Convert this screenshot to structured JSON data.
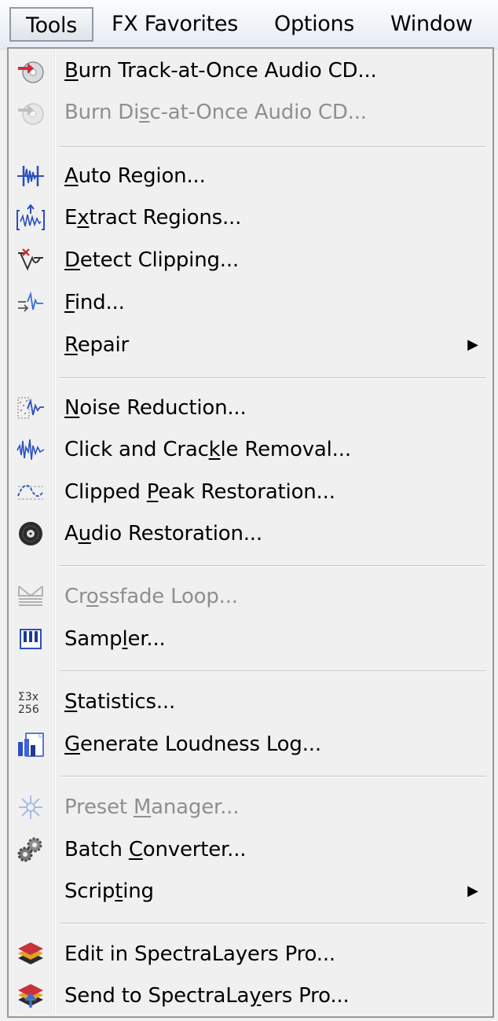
{
  "menubar": {
    "tools": "Tools",
    "fx_favorites": "FX Favorites",
    "options": "Options",
    "window": "Window"
  },
  "menu": {
    "items": [
      {
        "icon": "burn-cd-icon",
        "pre": "",
        "key": "B",
        "post": "urn Track-at-Once Audio CD..."
      },
      {
        "icon": "burn-cd-icon",
        "pre": "Burn Di",
        "key": "s",
        "post": "c-at-Once Audio CD..."
      },
      {
        "icon": "auto-region-icon",
        "pre": "",
        "key": "A",
        "post": "uto Region..."
      },
      {
        "icon": "extract-regions-icon",
        "pre": "E",
        "key": "x",
        "post": "tract Regions..."
      },
      {
        "icon": "detect-clipping-icon",
        "pre": "",
        "key": "D",
        "post": "etect Clipping..."
      },
      {
        "icon": "find-icon",
        "pre": "",
        "key": "F",
        "post": "ind..."
      },
      {
        "icon": "",
        "pre": "",
        "key": "R",
        "post": "epair"
      },
      {
        "icon": "noise-reduction-icon",
        "pre": "",
        "key": "N",
        "post": "oise Reduction..."
      },
      {
        "icon": "click-crackle-icon",
        "pre": "Click and Crac",
        "key": "k",
        "post": "le Removal..."
      },
      {
        "icon": "clipped-peak-icon",
        "pre": "Clipped ",
        "key": "P",
        "post": "eak Restoration..."
      },
      {
        "icon": "audio-restoration-icon",
        "pre": "A",
        "key": "u",
        "post": "dio Restoration..."
      },
      {
        "icon": "crossfade-loop-icon",
        "pre": "Cr",
        "key": "o",
        "post": "ssfade Loop..."
      },
      {
        "icon": "sampler-icon",
        "pre": "Samp",
        "key": "l",
        "post": "er..."
      },
      {
        "icon": "statistics-icon",
        "pre": "",
        "key": "S",
        "post": "tatistics..."
      },
      {
        "icon": "loudness-log-icon",
        "pre": "",
        "key": "G",
        "post": "enerate Loudness Log..."
      },
      {
        "icon": "preset-manager-icon",
        "pre": "Preset ",
        "key": "M",
        "post": "anager..."
      },
      {
        "icon": "batch-converter-icon",
        "pre": "Batch ",
        "key": "C",
        "post": "onverter..."
      },
      {
        "icon": "",
        "pre": "Scrip",
        "key": "t",
        "post": "ing"
      },
      {
        "icon": "spectralayers-edit-icon",
        "pre": "Edit in SpectraLayers Pro...",
        "key": "",
        "post": ""
      },
      {
        "icon": "spectralayers-send-icon",
        "pre": "Send to SpectraLa",
        "key": "y",
        "post": "ers Pro..."
      }
    ]
  },
  "submenu_arrow": "▶"
}
